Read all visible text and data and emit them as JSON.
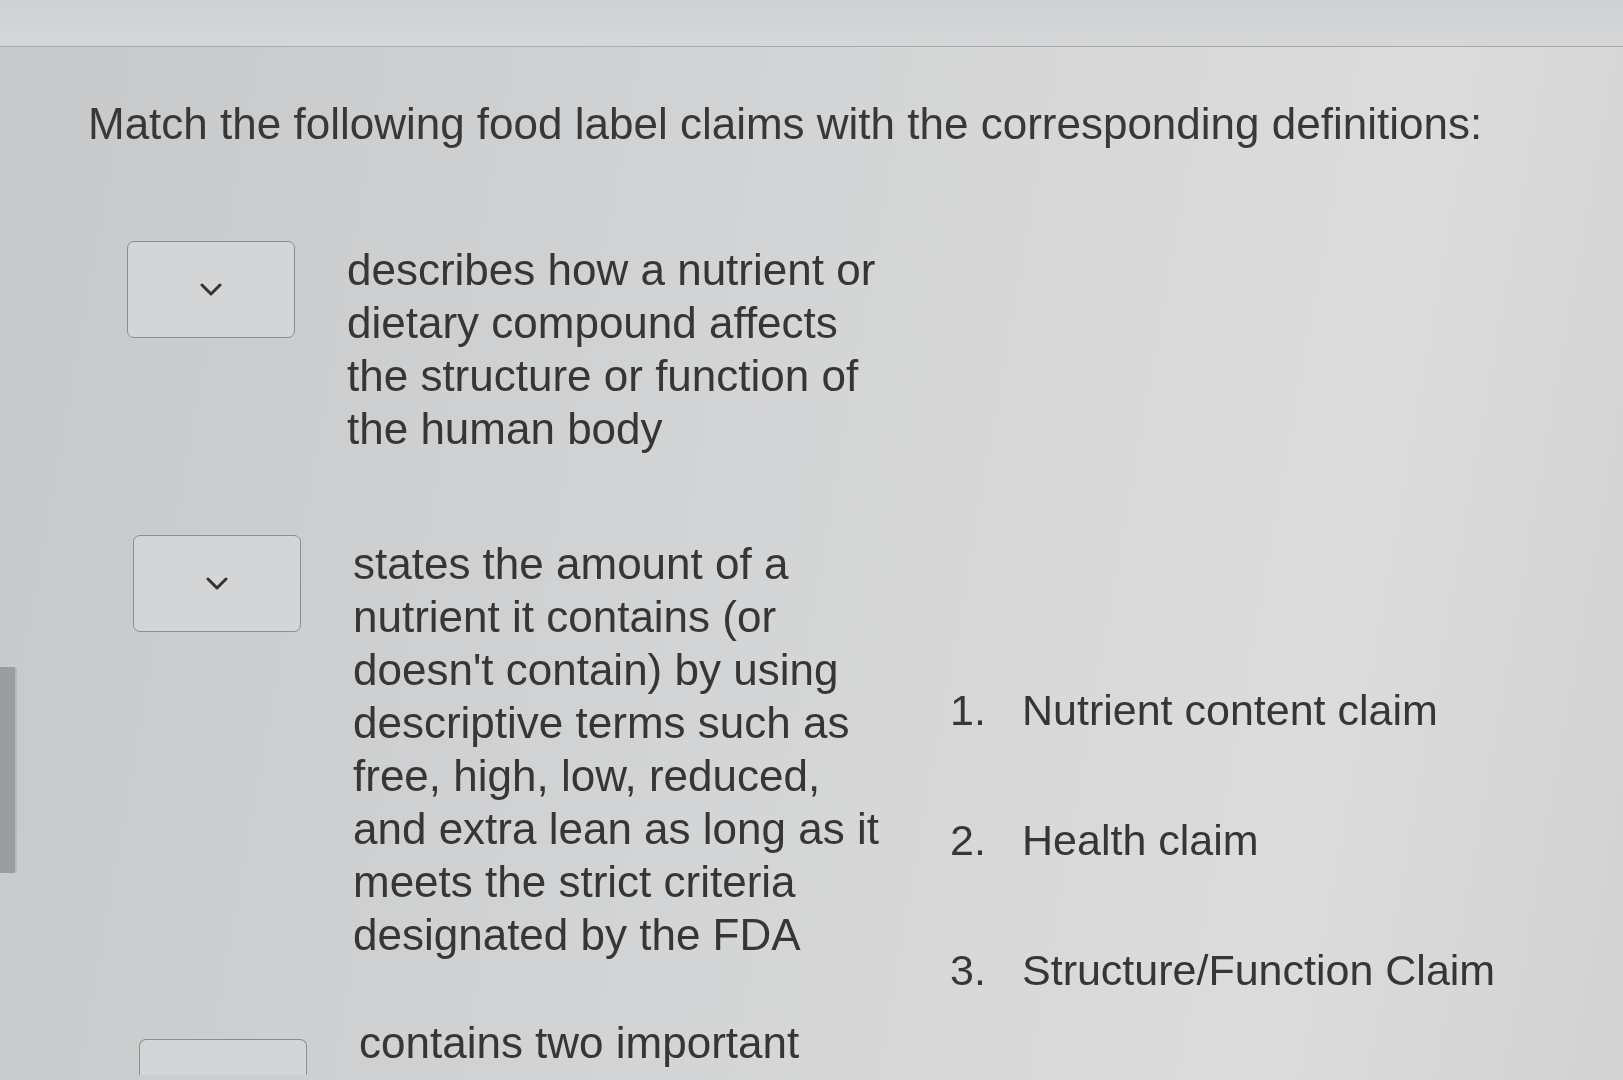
{
  "question": "Match the following food label claims with the corresponding definitions:",
  "items": [
    {
      "definition": "describes how a nutrient or\ndietary compound affects\nthe structure or function of\nthe human body"
    },
    {
      "definition": "states the amount of a\nnutrient it contains (or\ndoesn't contain) by using\ndescriptive terms such as\nfree, high, low, reduced,\nand extra lean as long as it\nmeets the strict criteria\ndesignated by the FDA"
    },
    {
      "definition": "contains two important"
    }
  ],
  "choices": [
    {
      "number": "1.",
      "label": "Nutrient content claim"
    },
    {
      "number": "2.",
      "label": "Health claim"
    },
    {
      "number": "3.",
      "label": "Structure/Function Claim"
    }
  ]
}
